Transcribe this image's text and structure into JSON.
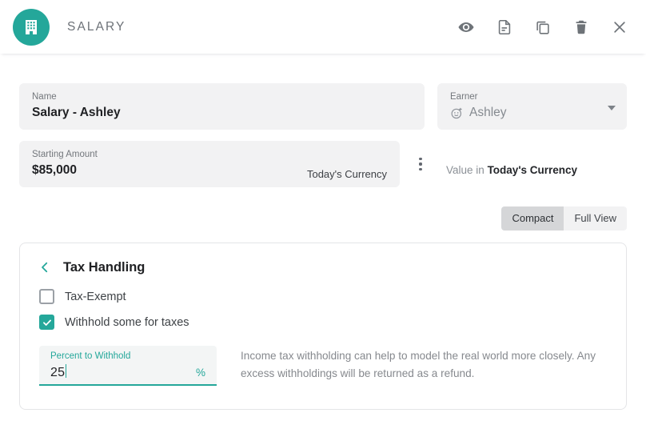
{
  "header": {
    "title": "SALARY",
    "brand_icon": "building-icon",
    "accent_color": "#24a79a",
    "actions": [
      {
        "name": "visibility-icon",
        "label": "Preview"
      },
      {
        "name": "notes-icon",
        "label": "Notes"
      },
      {
        "name": "duplicate-icon",
        "label": "Duplicate"
      },
      {
        "name": "delete-icon",
        "label": "Delete"
      },
      {
        "name": "close-icon",
        "label": "Close"
      }
    ]
  },
  "fields": {
    "name": {
      "label": "Name",
      "value": "Salary - Ashley"
    },
    "earner": {
      "label": "Earner",
      "value": "Ashley",
      "icon": "face-avatar-icon"
    },
    "starting_amount": {
      "label": "Starting Amount",
      "value": "$85,000",
      "suffix": "Today's Currency"
    },
    "value_in": {
      "prefix": "Value in",
      "emphasis": "Today's Currency"
    }
  },
  "view_toggle": {
    "options": [
      "Compact",
      "Full View"
    ],
    "selected": "Compact"
  },
  "tax_card": {
    "title": "Tax Handling",
    "back_icon": "chevron-left-icon",
    "checkboxes": [
      {
        "label": "Tax-Exempt",
        "checked": false
      },
      {
        "label": "Withhold some for taxes",
        "checked": true
      }
    ],
    "percent_field": {
      "label": "Percent to Withhold",
      "value": "25",
      "unit": "%",
      "focused": true
    },
    "description": "Income tax withholding can help to model the real world more closely. Any excess withholdings will be returned as a refund."
  }
}
